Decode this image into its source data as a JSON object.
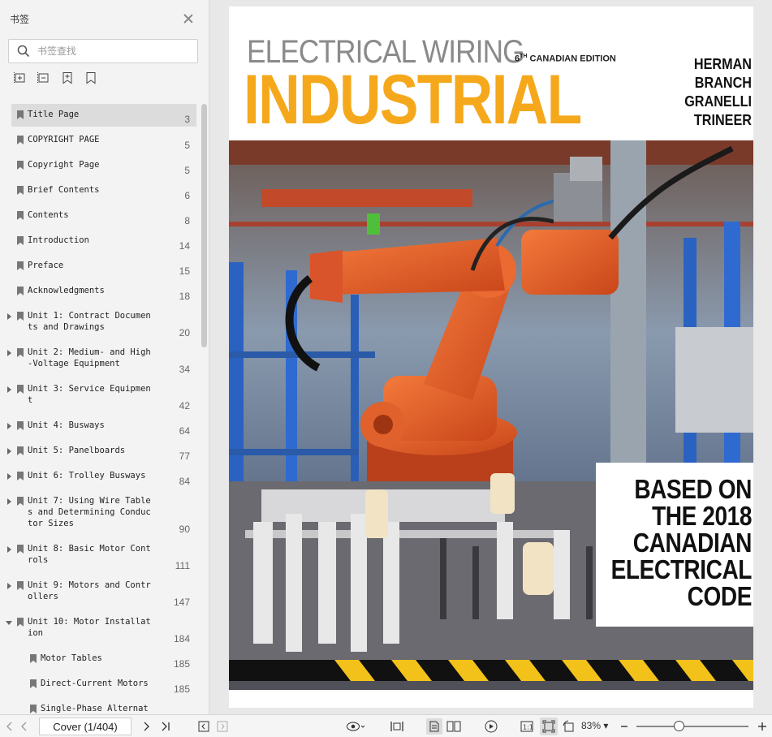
{
  "sidebar": {
    "title": "书签",
    "search_placeholder": "书签查找",
    "bookmarks": [
      {
        "label": "Title Page",
        "page": "3",
        "selected": true
      },
      {
        "label": "COPYRIGHT PAGE",
        "page": "5"
      },
      {
        "label": "Copyright Page",
        "page": "5"
      },
      {
        "label": "Brief Contents",
        "page": "6"
      },
      {
        "label": "Contents",
        "page": "8"
      },
      {
        "label": "Introduction",
        "page": "14"
      },
      {
        "label": "Preface",
        "page": "15"
      },
      {
        "label": "Acknowledgments",
        "page": "18"
      },
      {
        "label": "Unit 1: Contract Documen\nts and Drawings",
        "page": "20",
        "expandable": true
      },
      {
        "label": "Unit 2: Medium- and High\n-Voltage Equipment",
        "page": "34",
        "expandable": true
      },
      {
        "label": "Unit 3: Service Equipmen\nt",
        "page": "42",
        "expandable": true
      },
      {
        "label": "Unit 4: Busways",
        "page": "64",
        "expandable": true
      },
      {
        "label": "Unit 5: Panelboards",
        "page": "77",
        "expandable": true
      },
      {
        "label": "Unit 6: Trolley Busways",
        "page": "84",
        "expandable": true
      },
      {
        "label": "Unit 7: Using Wire Table\ns and Determining Conduc\ntor Sizes",
        "page": "90",
        "expandable": true
      },
      {
        "label": "Unit 8: Basic Motor Cont\nrols",
        "page": "111",
        "expandable": true
      },
      {
        "label": "Unit 9: Motors and Contr\nollers",
        "page": "147",
        "expandable": true
      },
      {
        "label": "Unit 10: Motor Installat\nion",
        "page": "184",
        "expandable": true,
        "open": true
      },
      {
        "label": "Motor Tables",
        "page": "185",
        "sub": true
      },
      {
        "label": "Direct-Current Motors",
        "page": "185",
        "sub": true
      },
      {
        "label": "Single-Phase Alternat\ning-Current Motors",
        "page": "185",
        "sub": true
      }
    ]
  },
  "cover": {
    "subtitle": "ELECTRICAL WIRING",
    "edition_num": "6",
    "edition_sup": "TH",
    "edition_text": " CANADIAN EDITION",
    "title": "INDUSTRIAL",
    "authors": [
      "HERMAN",
      "BRANCH",
      "GRANELLI",
      "TRINEER"
    ],
    "callout": [
      "BASED ON",
      "THE 2018",
      "CANADIAN",
      "ELECTRICAL",
      "CODE"
    ]
  },
  "toolbar": {
    "page_field": "Cover (1/404)",
    "zoom": "83%",
    "zoom_level": 0.38
  }
}
